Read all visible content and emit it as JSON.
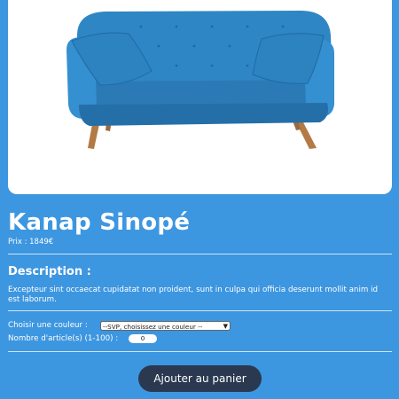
{
  "product": {
    "name": "Kanap Sinopé",
    "price_text": "Prix : 1849€",
    "image_icon": "sofa-image"
  },
  "description": {
    "heading": "Description :",
    "text": "Excepteur sint occaecat cupidatat non proident, sunt in culpa qui officia deserunt mollit anim id est laborum."
  },
  "options": {
    "color_label": "Choisir une couleur :",
    "color_selected": "--SVP, choisissez une couleur --",
    "quantity_label": "Nombre d'article(s) (1-100) :",
    "quantity_value": "0"
  },
  "actions": {
    "add_to_cart": "Ajouter au panier"
  },
  "colors": {
    "background": "#3d96e0",
    "sofa": "#2f86c4",
    "button": "#2a3950"
  }
}
